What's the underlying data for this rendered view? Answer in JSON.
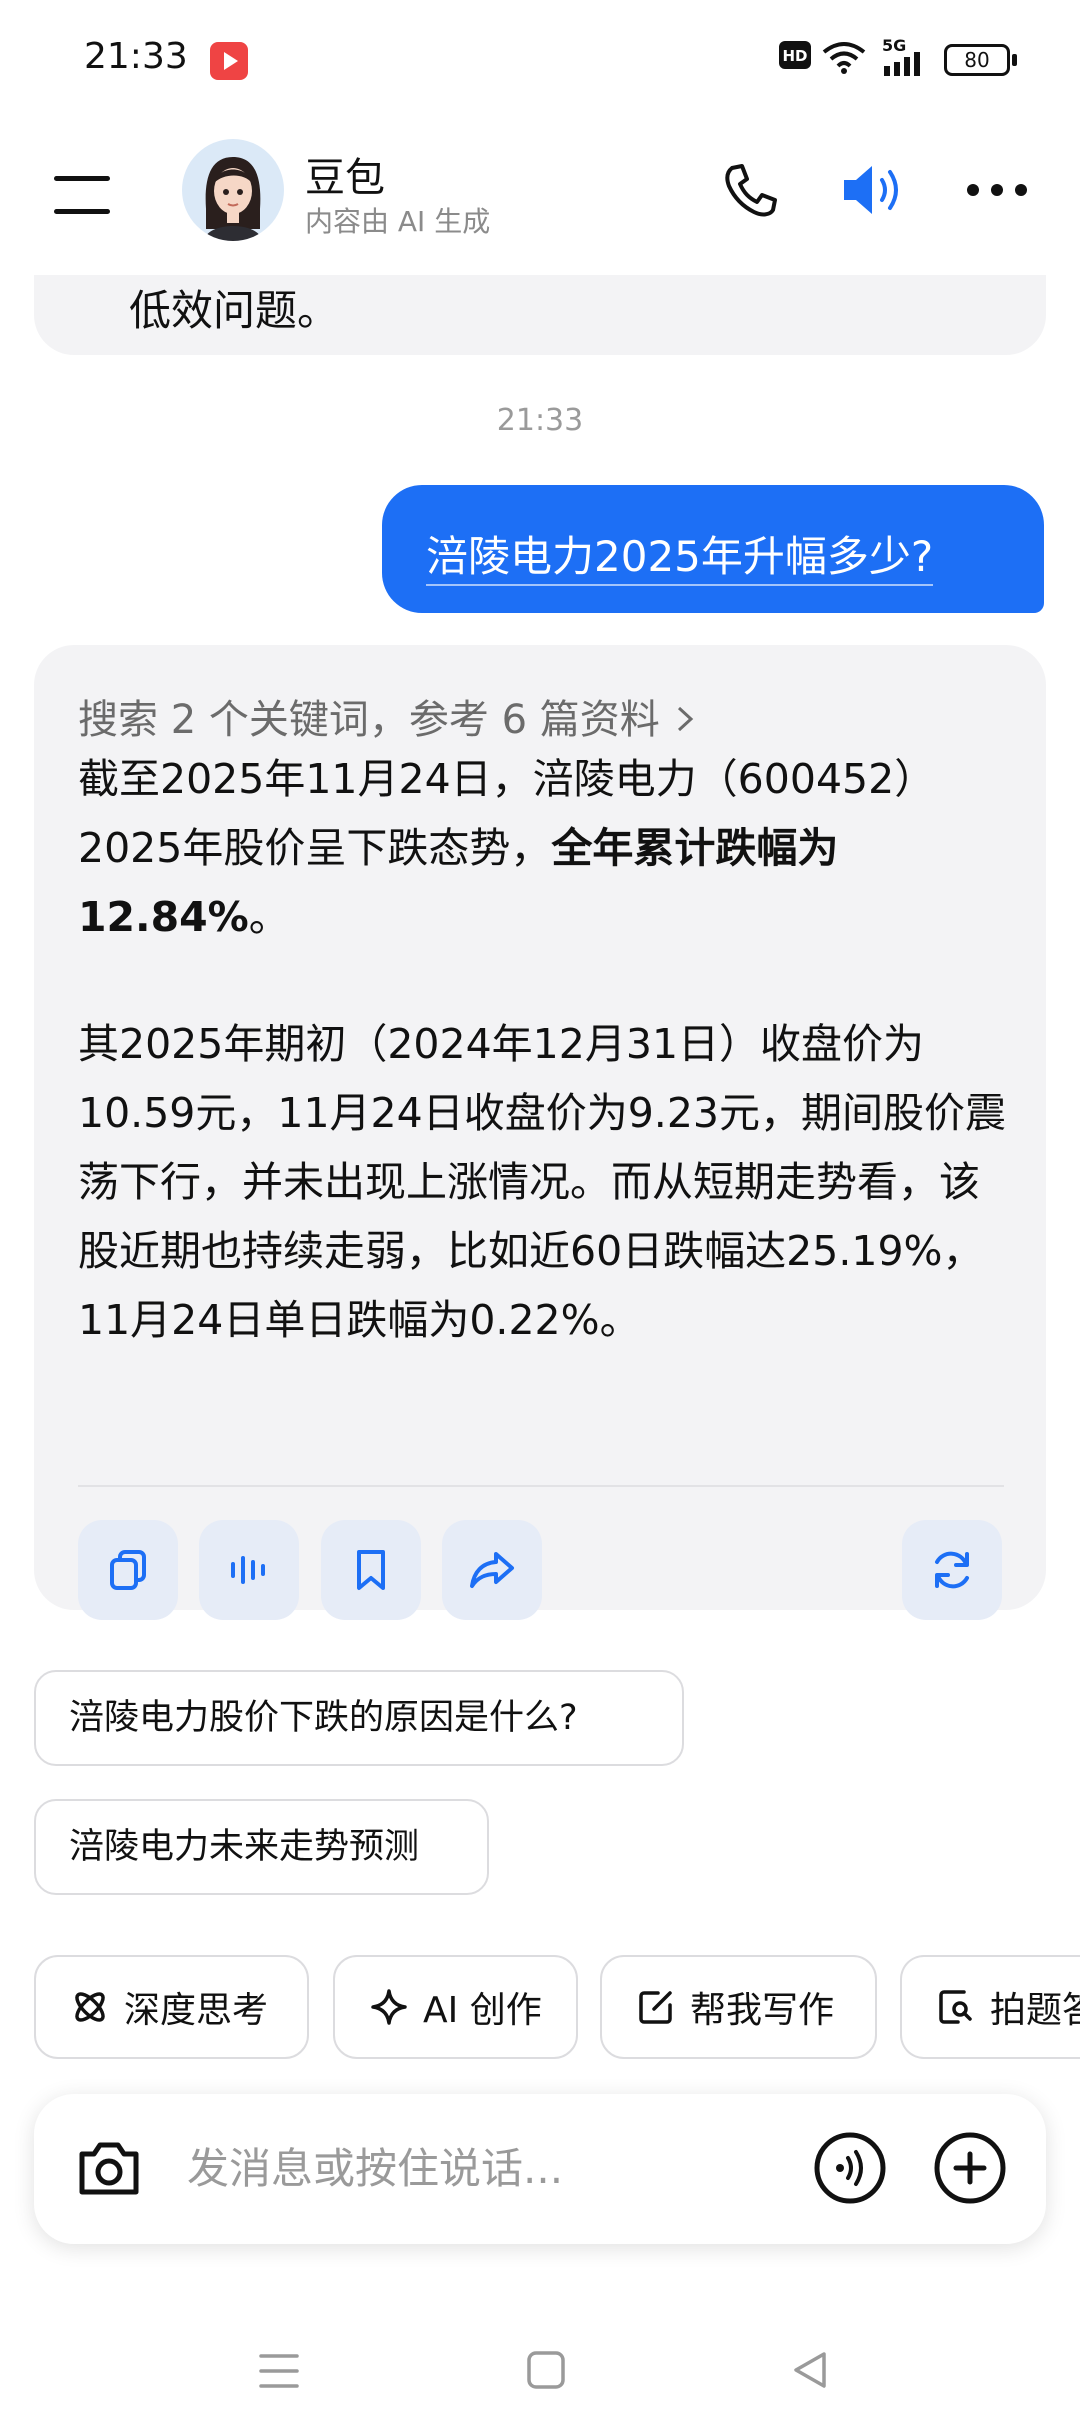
{
  "status_bar": {
    "time": "21:33",
    "network": "5G",
    "battery": "80"
  },
  "header": {
    "title": "豆包",
    "subtitle": "内容由 AI 生成"
  },
  "chat": {
    "prev_fragment": "低效问题。",
    "timestamp": "21:33",
    "user_message": "涪陵电力2025年升幅多少?",
    "bot": {
      "search_ref": "搜索 2 个关键词，参考 6 篇资料",
      "para1_prefix": "截至2025年11月24日，涪陵电力（600452）2025年股价呈下跌态势，",
      "para1_bold": "全年累计跌幅为12.84%",
      "para1_suffix": "。",
      "para2": "其2025年期初（2024年12月31日）收盘价为10.59元，11月24日收盘价为9.23元，期间股价震荡下行，并未出现上涨情况。而从短期走势看，该股近期也持续走弱，比如近60日跌幅达25.19%，11月24日单日跌幅为0.22%。"
    },
    "suggestions": [
      "涪陵电力股价下跌的原因是什么?",
      "涪陵电力未来走势预测"
    ]
  },
  "toolbar": {
    "chips": [
      "深度思考",
      "AI 创作",
      "帮我写作",
      "拍题答疑"
    ]
  },
  "input": {
    "placeholder": "发消息或按住说话..."
  },
  "colors": {
    "accent": "#1d6ff5",
    "bubble_gray": "#f3f3f5"
  }
}
